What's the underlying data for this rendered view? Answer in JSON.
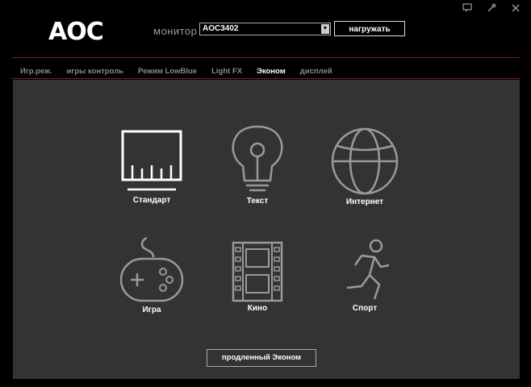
{
  "app": {
    "logo": "AOC"
  },
  "window": {
    "controls": [
      "minimize-icon",
      "settings-icon",
      "close-icon"
    ]
  },
  "header": {
    "monitor_label": "монитор",
    "monitor_value": "AOC3402",
    "load_button": "нагружать"
  },
  "tabs": [
    {
      "label": "Игр.реж.",
      "active": false
    },
    {
      "label": "игры контроль",
      "active": false
    },
    {
      "label": "Режим LowBlue",
      "active": false
    },
    {
      "label": "Light FX",
      "active": false
    },
    {
      "label": "Эконом",
      "active": true
    },
    {
      "label": "дисплей",
      "active": false
    }
  ],
  "modes": [
    {
      "label": "Стандарт",
      "icon": "monitor-icon"
    },
    {
      "label": "Текст",
      "icon": "lightbulb-icon"
    },
    {
      "label": "Интернет",
      "icon": "globe-icon"
    },
    {
      "label": "Игра",
      "icon": "gamepad-icon"
    },
    {
      "label": "Кино",
      "icon": "film-icon"
    },
    {
      "label": "Спорт",
      "icon": "runner-icon"
    }
  ],
  "extended_button": "продленный Эконом",
  "colors": {
    "accent": "#8a1420",
    "panel": "#333333",
    "icon": "#9a9a9a",
    "selected_icon": "#ffffff"
  }
}
